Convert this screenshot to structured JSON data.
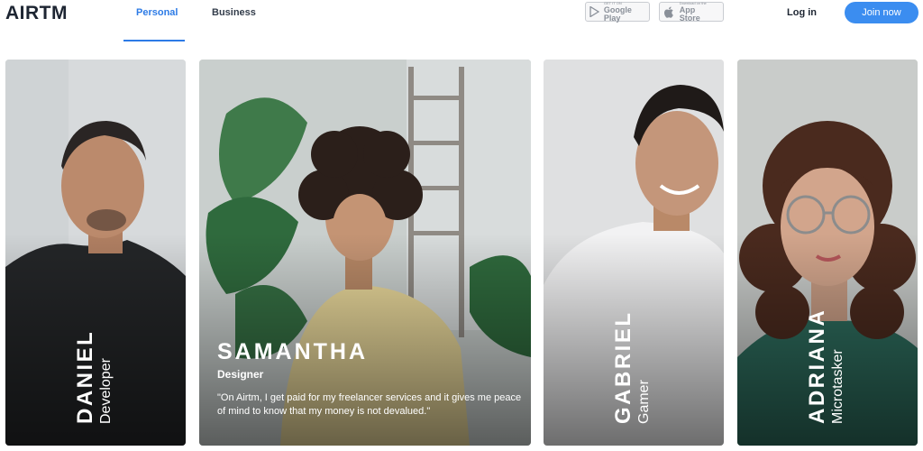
{
  "brand": {
    "logo_text": "AIRTM",
    "accent": "#2d7be6",
    "join_color": "#3b8df0"
  },
  "nav": {
    "tabs": [
      {
        "label": "Personal",
        "active": true
      },
      {
        "label": "Business",
        "active": false
      }
    ]
  },
  "stores": {
    "google_play": {
      "small": "GET IT ON",
      "big": "Google Play",
      "icon": "play-triangle-icon"
    },
    "app_store": {
      "small": "Download on the",
      "big": "App Store",
      "icon": "apple-icon"
    }
  },
  "auth": {
    "login_label": "Log in",
    "join_label": "Join now"
  },
  "cards": [
    {
      "name": "DANIEL",
      "role": "Developer"
    },
    {
      "name": "SAMANTHA",
      "role": "Designer",
      "quote": "\"On Airtm, I get paid for my freelancer services and it gives me peace of mind to know that my money is not devalued.\""
    },
    {
      "name": "GABRIEL",
      "role": "Gamer"
    },
    {
      "name": "ADRIANA",
      "role": "Microtasker"
    }
  ]
}
